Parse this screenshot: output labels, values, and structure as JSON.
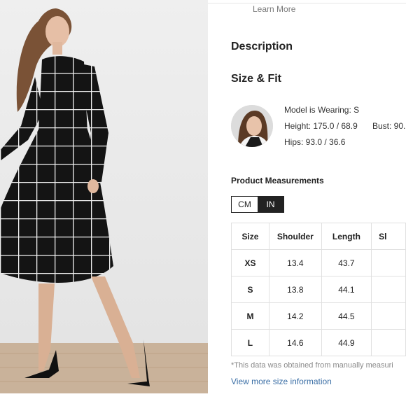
{
  "header": {
    "learn_more": "Learn More"
  },
  "sections": {
    "description": "Description",
    "size_fit": "Size & Fit"
  },
  "model": {
    "wearing": "Model is Wearing: S",
    "height": "Height: 175.0 / 68.9",
    "bust": "Bust: 90.",
    "hips": "Hips: 93.0 / 36.6"
  },
  "measurements": {
    "title": "Product Measurements",
    "units": [
      "CM",
      "IN"
    ],
    "selected_unit": "IN",
    "columns": [
      "Size",
      "Shoulder",
      "Length",
      "Sl"
    ],
    "rows": [
      {
        "size": "XS",
        "shoulder": "13.4",
        "length": "43.7"
      },
      {
        "size": "S",
        "shoulder": "13.8",
        "length": "44.1"
      },
      {
        "size": "M",
        "shoulder": "14.2",
        "length": "44.5"
      },
      {
        "size": "L",
        "shoulder": "14.6",
        "length": "44.9"
      }
    ]
  },
  "footnote": "*This data was obtained from manually measuri",
  "view_more": "View more size information",
  "colors": {
    "link": "#3a6ea5",
    "selected_unit_bg": "#222222",
    "border": "#e0e0e0"
  }
}
